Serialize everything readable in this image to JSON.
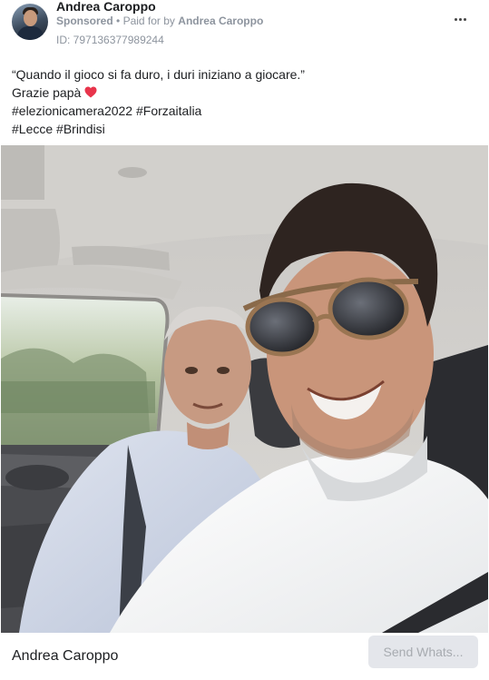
{
  "header": {
    "author_name": "Andrea Caroppo",
    "sponsored_label": "Sponsored",
    "paid_for_prefix": "Paid for by",
    "payer_name": "Andrea Caroppo",
    "ad_id": "ID: 797136377989244",
    "more_icon": "more-horizontal-icon"
  },
  "post": {
    "lines": [
      "“Quando il gioco si fa duro, i duri iniziano a giocare.”",
      "Grazie papà",
      "#elezionicamera2022 #Forzaitalia",
      "#Lecce #Brindisi"
    ],
    "heart_icon": "red-heart-icon",
    "heart_color": "#e8344b"
  },
  "footer": {
    "page_name": "Andrea Caroppo",
    "cta_label": "Send Whats..."
  },
  "colors": {
    "meta_gray": "#8d949e",
    "cta_bg": "#e4e6eb",
    "cta_text": "#a7abb0"
  }
}
